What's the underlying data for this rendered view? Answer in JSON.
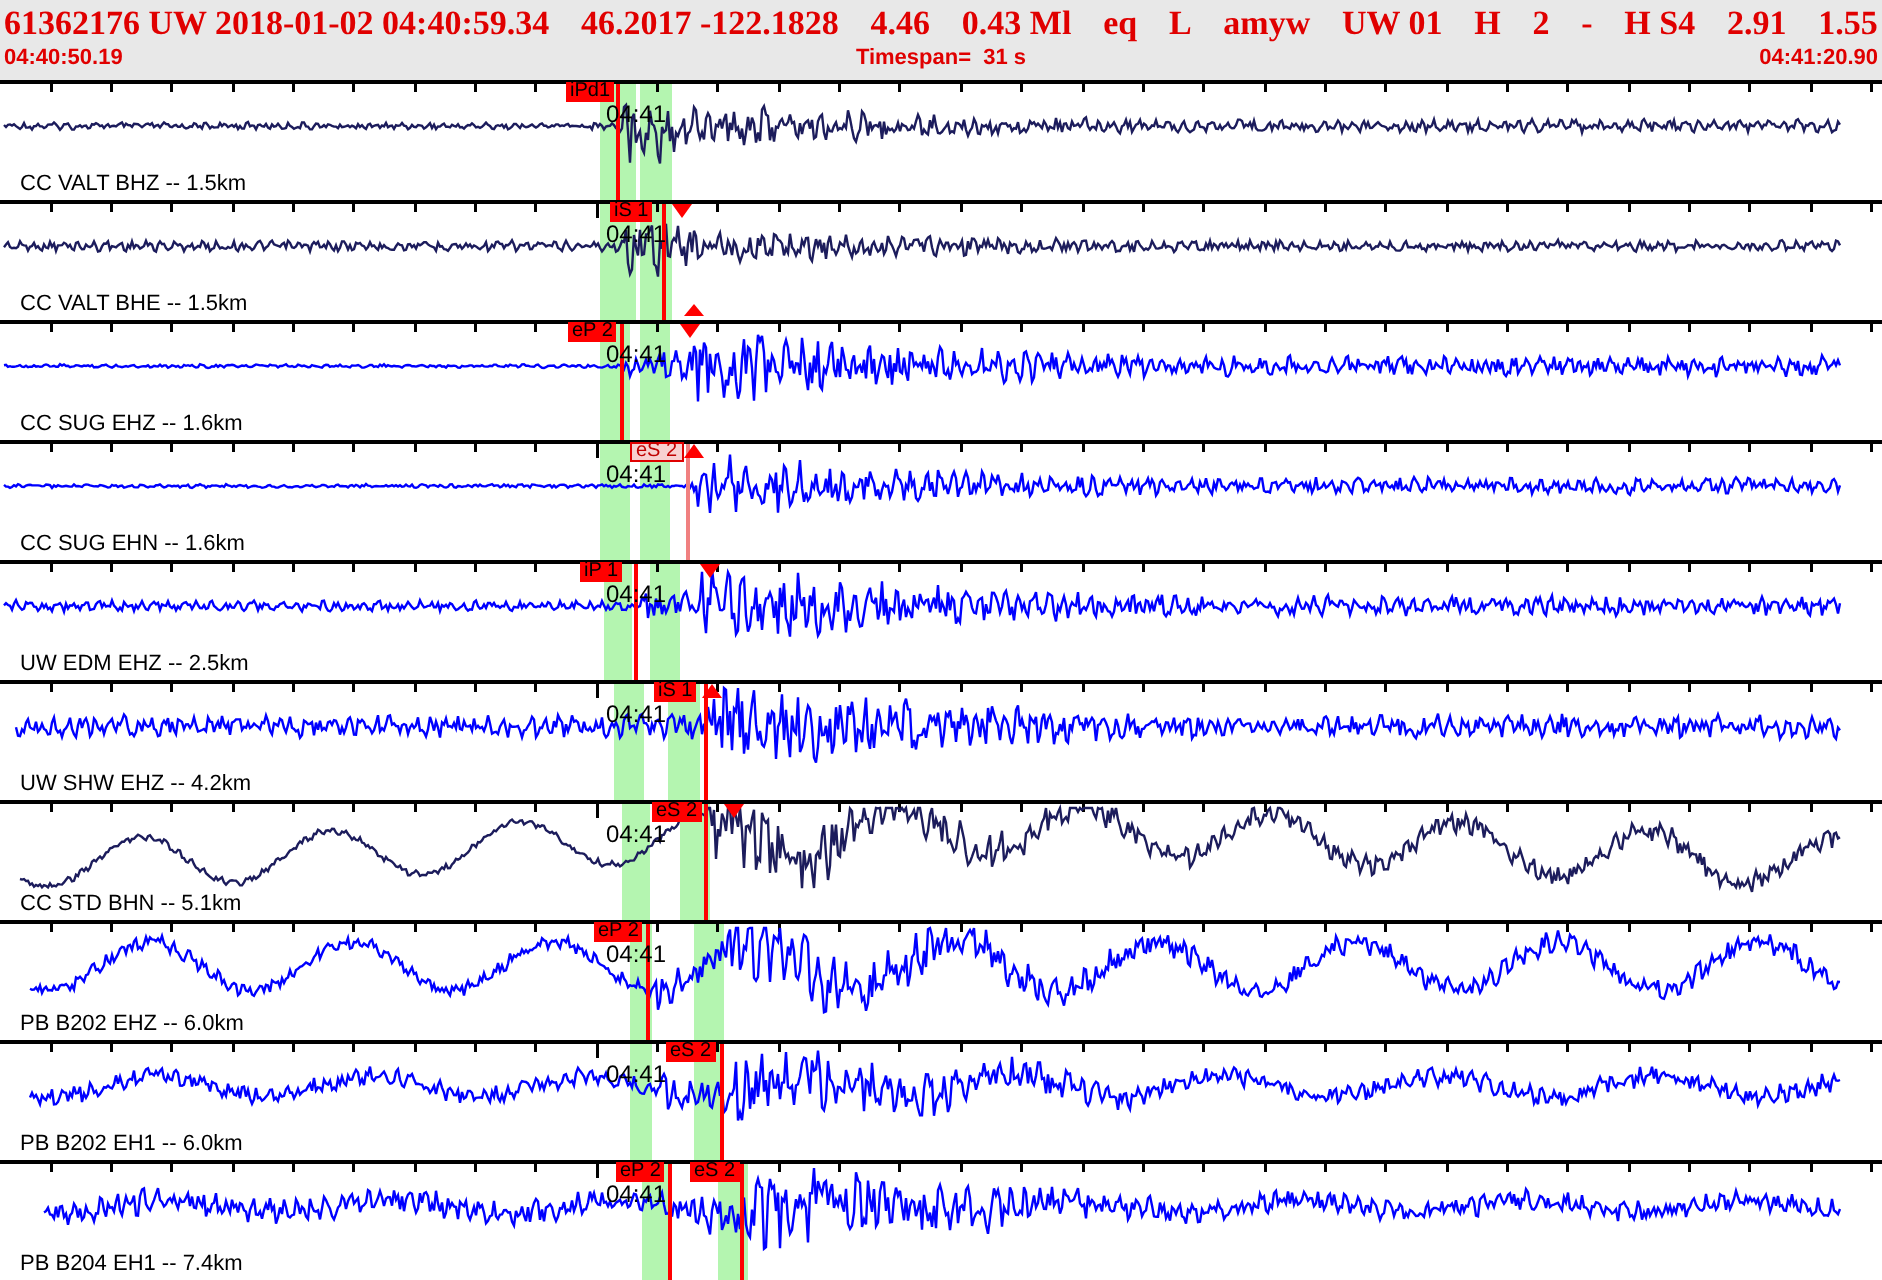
{
  "header": {
    "summary_fields": [
      "61362176 UW 2018-01-02 04:40:59.34",
      "46.2017 -122.1828",
      "4.46",
      "0.43 Ml",
      "eq",
      "L",
      "amyw",
      "UW 01",
      "H",
      "2",
      "-",
      "H S4",
      "2.91",
      "1.55"
    ],
    "start_time": "04:40:50.19",
    "timespan": "Timespan=  31 s",
    "end_time": "04:41:20.90"
  },
  "traces": [
    {
      "label": "CC VALT BHZ -- 1.5km",
      "time_mark": "04:41",
      "color": "#1c1c5c",
      "picks": [
        {
          "label": "iPd1",
          "faded": false
        }
      ]
    },
    {
      "label": "CC VALT BHE -- 1.5km",
      "time_mark": "04:41",
      "color": "#1c1c5c",
      "picks": [
        {
          "label": "iS 1",
          "faded": false
        }
      ]
    },
    {
      "label": "CC SUG EHZ -- 1.6km",
      "time_mark": "04:41",
      "color": "#0000ff",
      "picks": [
        {
          "label": "eP 2",
          "faded": false
        }
      ]
    },
    {
      "label": "CC SUG EHN -- 1.6km",
      "time_mark": "04:41",
      "color": "#0000ff",
      "picks": [
        {
          "label": "eS 2",
          "faded": true
        }
      ]
    },
    {
      "label": "UW EDM EHZ -- 2.5km",
      "time_mark": "04:41",
      "color": "#0000ff",
      "picks": [
        {
          "label": "iP 1",
          "faded": false
        }
      ]
    },
    {
      "label": "UW SHW EHZ -- 4.2km",
      "time_mark": "04:41",
      "color": "#0000ff",
      "picks": [
        {
          "label": "iS 1",
          "faded": false
        }
      ]
    },
    {
      "label": "CC STD BHN -- 5.1km",
      "time_mark": "04:41",
      "color": "#1c1c5c",
      "picks": [
        {
          "label": "eS 2",
          "faded": false
        }
      ]
    },
    {
      "label": "PB B202 EHZ -- 6.0km",
      "time_mark": "04:41",
      "color": "#0000ff",
      "picks": [
        {
          "label": "eP 2",
          "faded": false
        }
      ]
    },
    {
      "label": "PB B202 EH1 -- 6.0km",
      "time_mark": "04:41",
      "color": "#0000ff",
      "picks": [
        {
          "label": "eS 2",
          "faded": false
        }
      ]
    },
    {
      "label": "PB B204 EH1 -- 7.4km",
      "time_mark": "04:41",
      "color": "#0000ff",
      "picks": [
        {
          "label": "eP 2",
          "faded": false
        },
        {
          "label": "eS 2",
          "faded": false
        }
      ]
    }
  ]
}
